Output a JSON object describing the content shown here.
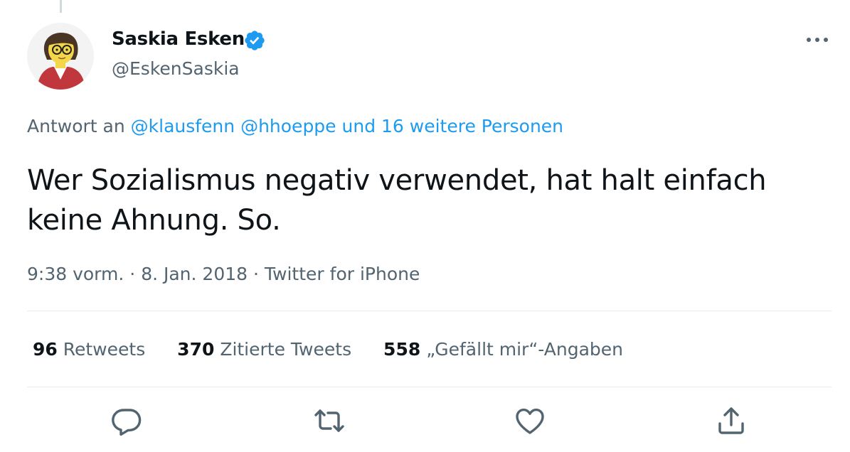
{
  "author": {
    "display_name": "Saskia Esken",
    "handle": "@EskenSaskia",
    "verified": true
  },
  "reply": {
    "prefix": "Antwort an",
    "mentions": "@klausfenn @hhoeppe und 16 weitere Personen"
  },
  "tweet": {
    "text": "Wer Sozialismus negativ verwendet, hat halt einfach keine Ahnung. So."
  },
  "meta": {
    "time": "9:38 vorm.",
    "date": "8. Jan. 2018",
    "source": "Twitter for iPhone",
    "separator": "·"
  },
  "stats": {
    "retweets_count": "96",
    "retweets_label": "Retweets",
    "quotes_count": "370",
    "quotes_label": "Zitierte Tweets",
    "likes_count": "558",
    "likes_label": "„Gefällt mir“-Angaben"
  },
  "icons": {
    "verified": "verified-badge-icon",
    "more": "more-horizontal-icon",
    "reply": "reply-icon",
    "retweet": "retweet-icon",
    "like": "heart-icon",
    "share": "share-icon"
  },
  "colors": {
    "accent": "#1d9bf0",
    "text": "#0f1419",
    "muted": "#536471",
    "divider": "#e6ecf0"
  }
}
